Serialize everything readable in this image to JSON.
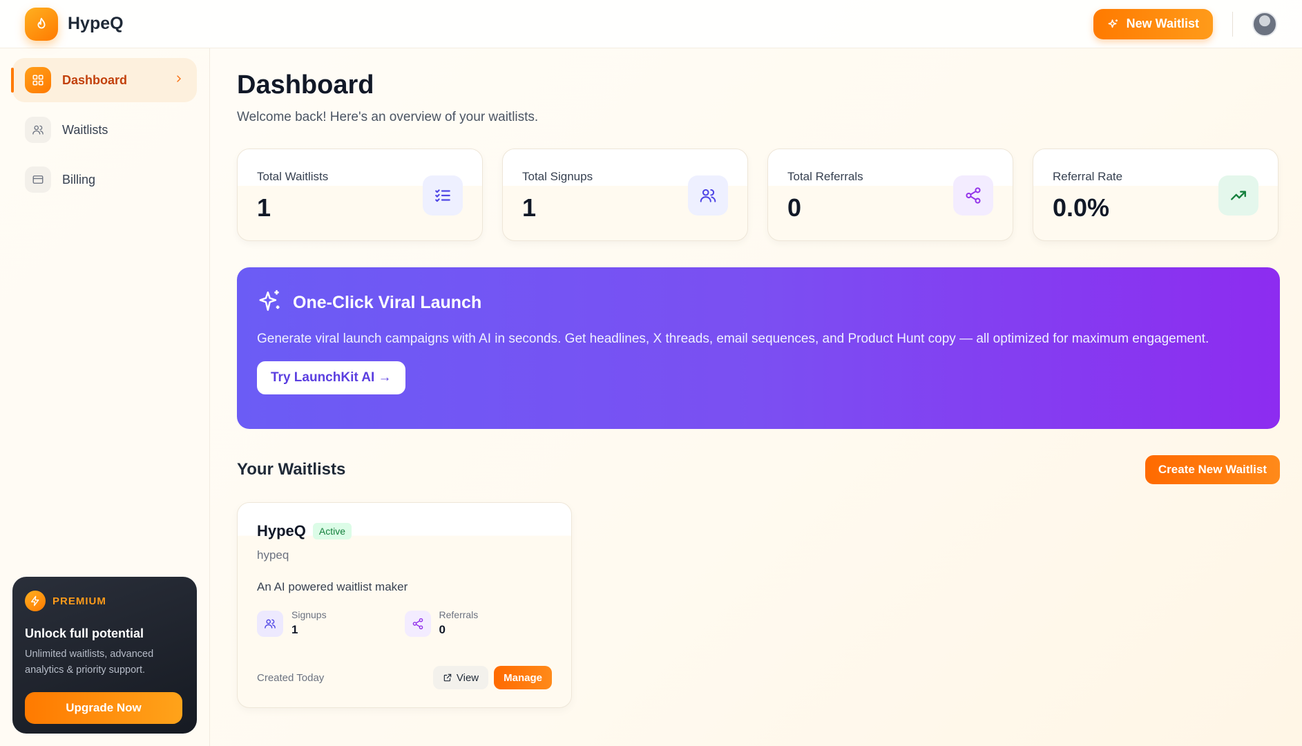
{
  "brand": {
    "name": "HypeQ",
    "logo_icon": "flame-icon"
  },
  "topbar": {
    "new_waitlist_label": "New Waitlist"
  },
  "sidebar": {
    "items": [
      {
        "label": "Dashboard",
        "icon": "grid-icon",
        "active": true
      },
      {
        "label": "Waitlists",
        "icon": "users-icon",
        "active": false
      },
      {
        "label": "Billing",
        "icon": "card-icon",
        "active": false
      }
    ],
    "premium": {
      "tag": "PREMIUM",
      "title": "Unlock full potential",
      "description": "Unlimited waitlists, advanced analytics & priority support.",
      "button_label": "Upgrade Now"
    }
  },
  "page": {
    "title": "Dashboard",
    "subtitle": "Welcome back! Here's an overview of your waitlists."
  },
  "stats": [
    {
      "label": "Total Waitlists",
      "value": "1",
      "icon": "checklist-icon",
      "icon_bg": "#eef0ff",
      "icon_color": "#4f46e5"
    },
    {
      "label": "Total Signups",
      "value": "1",
      "icon": "users-icon",
      "icon_bg": "#eef0ff",
      "icon_color": "#4f46e5"
    },
    {
      "label": "Total Referrals",
      "value": "0",
      "icon": "share-icon",
      "icon_bg": "#f3ecff",
      "icon_color": "#9333ea"
    },
    {
      "label": "Referral Rate",
      "value": "0.0%",
      "icon": "trending-up-icon",
      "icon_bg": "#e4f7ec",
      "icon_color": "#16a34a"
    }
  ],
  "banner": {
    "title": "One-Click Viral Launch",
    "description": "Generate viral launch campaigns with AI in seconds. Get headlines, X threads, email sequences, and Product Hunt copy — all optimized for maximum engagement.",
    "button_label": "Try LaunchKit AI →"
  },
  "waitlists_section": {
    "title": "Your Waitlists",
    "create_label": "Create New Waitlist",
    "cards": [
      {
        "name": "HypeQ",
        "status": "Active",
        "slug": "hypeq",
        "description": "An AI powered waitlist maker",
        "signups_label": "Signups",
        "signups": "1",
        "referrals_label": "Referrals",
        "referrals": "0",
        "created": "Created Today",
        "view_label": "View",
        "manage_label": "Manage"
      }
    ]
  },
  "colors": {
    "accent": "#ff7a00",
    "banner_start": "#6b5cf5",
    "banner_end": "#8d2cf0"
  }
}
